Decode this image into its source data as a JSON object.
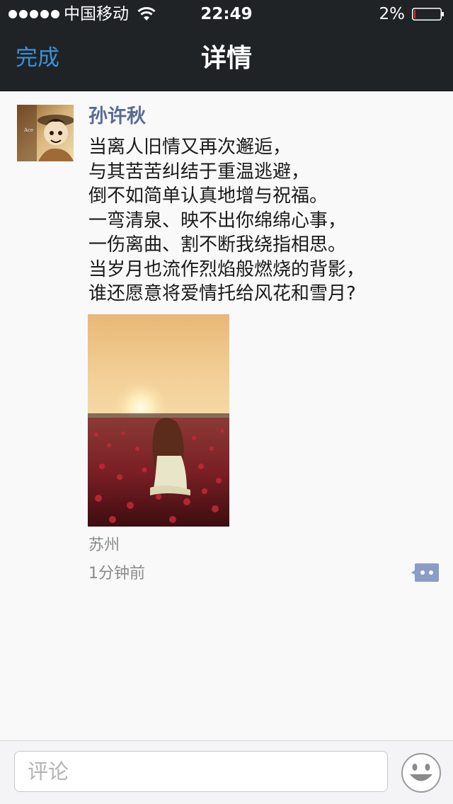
{
  "status_bar": {
    "carrier": "中国移动",
    "time": "22:49",
    "battery_percent": "2%",
    "battery_level": 0.02,
    "signal_bars": 5,
    "icons": [
      "signal-dots-icon",
      "wifi-icon",
      "battery-icon"
    ]
  },
  "nav": {
    "done_label": "完成",
    "title": "详情"
  },
  "post": {
    "author": "孙许秋",
    "lines": [
      "当离人旧情又再次邂逅，",
      "与其苦苦纠结于重温逃避，",
      "倒不如简单认真地增与祝福。",
      "一弯清泉、映不出你绵绵心事，",
      "一伤离曲、割不断我绕指相思。",
      "当岁月也流作烈焰般燃烧的背影，",
      "谁还愿意将爱情托给风花和雪月?"
    ],
    "location": "苏州",
    "time_ago": "1分钟前",
    "image_icon": "photo-girl-in-flower-field-at-sunset",
    "avatar_icon": "avatar-anime-character"
  },
  "comment_bar": {
    "placeholder": "评论",
    "emoji_icon": "smiley-face-icon"
  },
  "colors": {
    "bar_background": "#1f2326",
    "accent_blue": "#3f8fd6",
    "username_blue": "#576b95",
    "comment_button_bg": "#8a9cc8",
    "battery_low_red": "#e0292a"
  }
}
